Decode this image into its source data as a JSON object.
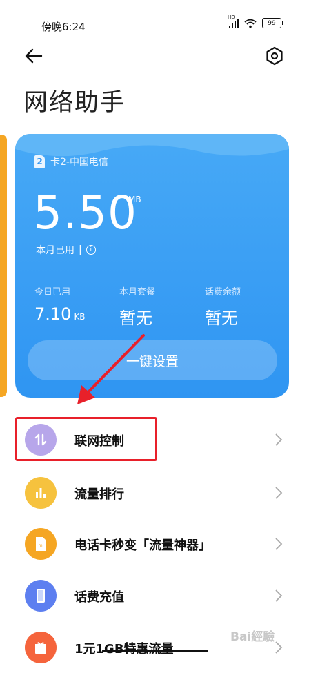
{
  "status_bar": {
    "time": "傍晚6:24",
    "network": "HD",
    "battery": "99"
  },
  "header": {
    "back_icon": "arrow-left-icon",
    "settings_icon": "gear-hexagon-icon",
    "title": "网络助手"
  },
  "card": {
    "sim_badge": "2",
    "sim_label": "卡2-中国电信",
    "usage_value": "5.50",
    "usage_unit": "MB",
    "usage_label": "本月已用",
    "stats": [
      {
        "label": "今日已用",
        "value": "7.10",
        "unit": "KB"
      },
      {
        "label": "本月套餐",
        "value": "暂无",
        "unit": ""
      },
      {
        "label": "话费余额",
        "value": "暂无",
        "unit": ""
      }
    ],
    "one_key_button": "一键设置",
    "colors": {
      "card_top": "#47a9f6",
      "card_bottom": "#2f95f2",
      "side_strip": "#f5a623"
    }
  },
  "menu": [
    {
      "label": "联网控制",
      "icon": "updown-arrows-icon",
      "color": "#b7a6ea"
    },
    {
      "label": "流量排行",
      "icon": "bar-chart-icon",
      "color": "#f6c23e"
    },
    {
      "label": "电话卡秒变「流量神器」",
      "icon": "sim-card-icon",
      "color": "#f5a623"
    },
    {
      "label": "话费充值",
      "icon": "phone-icon",
      "color": "#5d7ff0"
    },
    {
      "label": "1元1GB特惠流量",
      "icon": "gift-icon",
      "color": "#f5643c"
    }
  ],
  "annotation": {
    "highlight_color": "#e8202a"
  },
  "watermark": "Bai經驗"
}
